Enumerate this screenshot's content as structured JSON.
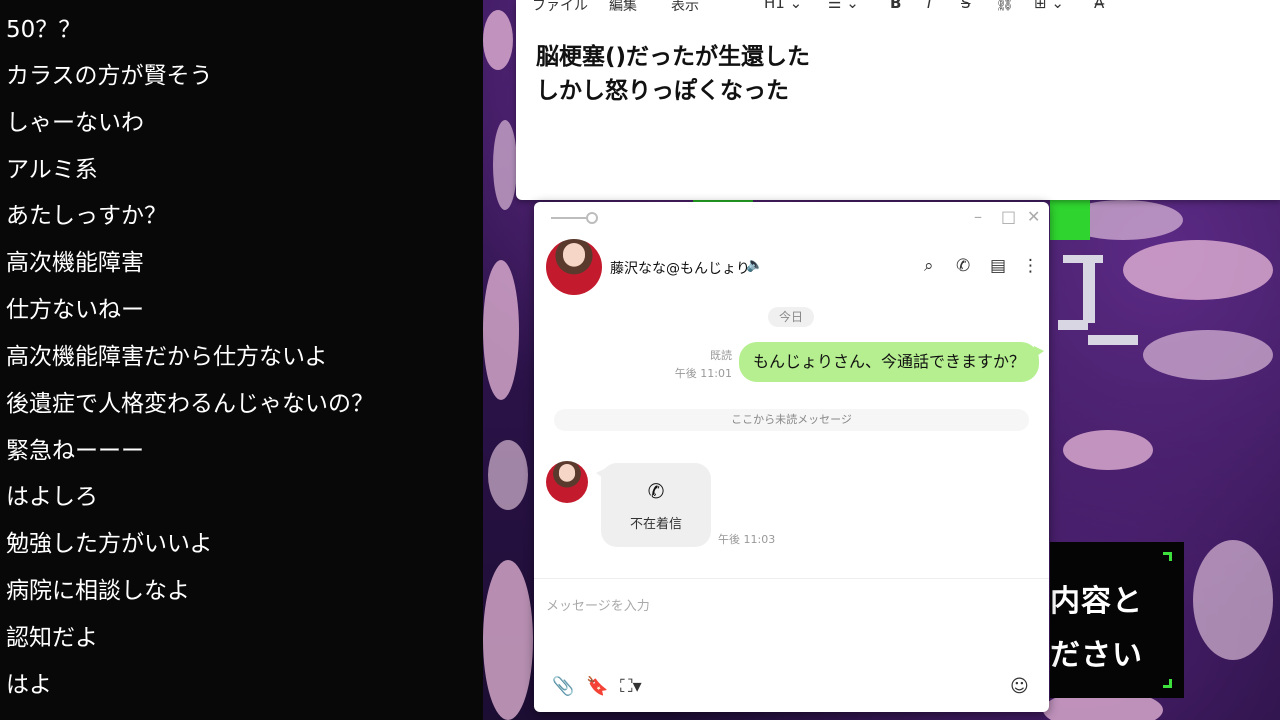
{
  "comments": [
    "50？？",
    "カラスの方が賢そう",
    "しゃーないわ",
    "アルミ系",
    "あたしっすか？",
    "高次機能障害",
    "仕方ないねー",
    "高次機能障害だから仕方ないよ",
    "後遺症で人格変わるんじゃないの？",
    "緊急ねーーー",
    "はよしろ",
    "勉強した方がいいよ",
    "病院に相談しなよ",
    "認知だよ",
    "はよ"
  ],
  "notepad": {
    "menu": [
      "ファイル",
      "編集",
      "表示"
    ],
    "toolbar": {
      "heading": "H1",
      "list_icon": "list-icon",
      "bold_label": "B",
      "italic_label": "I",
      "strike_label": "S",
      "link_icon": "link-icon",
      "table_icon": "table-icon",
      "spellcheck_icon": "spellcheck-icon"
    },
    "lines": [
      "脳梗塞()だったが生還した",
      "しかし怒りっぽくなった"
    ]
  },
  "chat": {
    "contact_name": "藤沢なな@もんじょり",
    "date_chip": "今日",
    "outgoing": {
      "read_label": "既読",
      "time": "午後 11:01",
      "text": "もんじょりさん、今通話できますか？"
    },
    "unread_divider": "ここから未読メッセージ",
    "missed_call": {
      "label": "不在着信",
      "time": "午後 11:03"
    },
    "input_placeholder": "メッセージを入力"
  },
  "game_dialog": {
    "line1": "内容と",
    "line2": "ださい"
  },
  "colors": {
    "outgoing_bubble": "#b5ef8f",
    "game_accent": "#2fd42f",
    "background_purple": "#3a1a5e"
  }
}
